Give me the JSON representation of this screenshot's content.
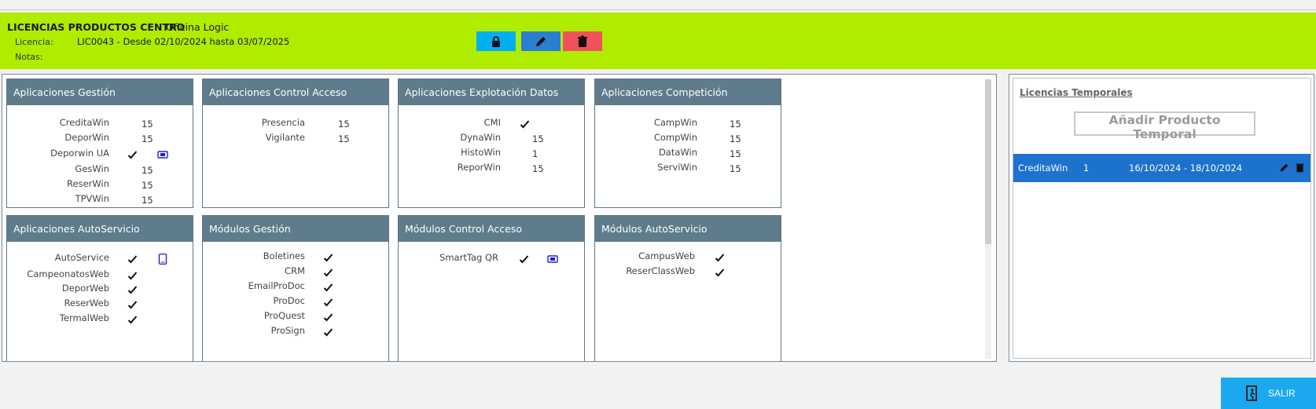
{
  "header": {
    "title": "LICENCIAS PRODUCTOS CENTRO",
    "center": "Oficina Logic",
    "licencia_label": "Licencia:",
    "licencia_value": "LIC0043 - Desde 02/10/2024 hasta 03/07/2025",
    "notas_label": "Notas:",
    "buttons": {
      "lock": "lock-icon",
      "edit": "pencil-icon",
      "delete": "trash-icon"
    }
  },
  "cards": [
    {
      "title": "Aplicaciones Gestión",
      "items": [
        {
          "name": "CreditaWin",
          "value": "15"
        },
        {
          "name": "DeporWin",
          "value": "15"
        },
        {
          "name": "Deporwin UA",
          "check": true,
          "icon": "dongle-icon"
        },
        {
          "name": "GesWin",
          "value": "15"
        },
        {
          "name": "ReserWin",
          "value": "15"
        },
        {
          "name": "TPVWin",
          "value": "15"
        }
      ]
    },
    {
      "title": "Aplicaciones Control Acceso",
      "items": [
        {
          "name": "Presencia",
          "value": "15"
        },
        {
          "name": "Vigilante",
          "value": "15"
        }
      ]
    },
    {
      "title": "Aplicaciones Explotación Datos",
      "items": [
        {
          "name": "CMI",
          "check": true
        },
        {
          "name": "DynaWin",
          "value": "15"
        },
        {
          "name": "HistoWin",
          "value": "1"
        },
        {
          "name": "ReporWin",
          "value": "15"
        }
      ]
    },
    {
      "title": "Aplicaciones Competición",
      "items": [
        {
          "name": "CampWin",
          "value": "15"
        },
        {
          "name": "CompWin",
          "value": "15"
        },
        {
          "name": "DataWin",
          "value": "15"
        },
        {
          "name": "ServiWin",
          "value": "15"
        }
      ]
    },
    {
      "title": "Aplicaciones AutoServicio",
      "items": [
        {
          "name": "AutoService",
          "check": true,
          "icon": "tablet-icon"
        },
        {
          "name": "CampeonatosWeb",
          "check": true
        },
        {
          "name": "DeporWeb",
          "check": true
        },
        {
          "name": "ReserWeb",
          "check": true
        },
        {
          "name": "TermalWeb",
          "check": true
        }
      ]
    },
    {
      "title": "Módulos Gestión",
      "items": [
        {
          "name": "Boletines",
          "check": true
        },
        {
          "name": "CRM",
          "check": true
        },
        {
          "name": "EmailProDoc",
          "check": true
        },
        {
          "name": "ProDoc",
          "check": true
        },
        {
          "name": "ProQuest",
          "check": true
        },
        {
          "name": "ProSign",
          "check": true
        }
      ]
    },
    {
      "title": "Módulos Control Acceso",
      "items": [
        {
          "name": "SmartTag QR",
          "check": true,
          "icon": "dongle-icon"
        }
      ]
    },
    {
      "title": "Módulos AutoServicio",
      "items": [
        {
          "name": "CampusWeb",
          "check": true
        },
        {
          "name": "ReserClassWeb",
          "check": true
        }
      ]
    }
  ],
  "temporales": {
    "title": "Licencias Temporales",
    "add_label": "Añadir Producto Temporal",
    "rows": [
      {
        "product": "CreditaWin",
        "qty": "1",
        "range": "16/10/2024 - 18/10/2024"
      }
    ]
  },
  "footer": {
    "salir_label": "SALIR"
  },
  "colors": {
    "header_bg": "#b0ec00",
    "card_header": "#5e7c8b",
    "selected_row": "#1c72cc",
    "salir": "#1aa9ef"
  }
}
